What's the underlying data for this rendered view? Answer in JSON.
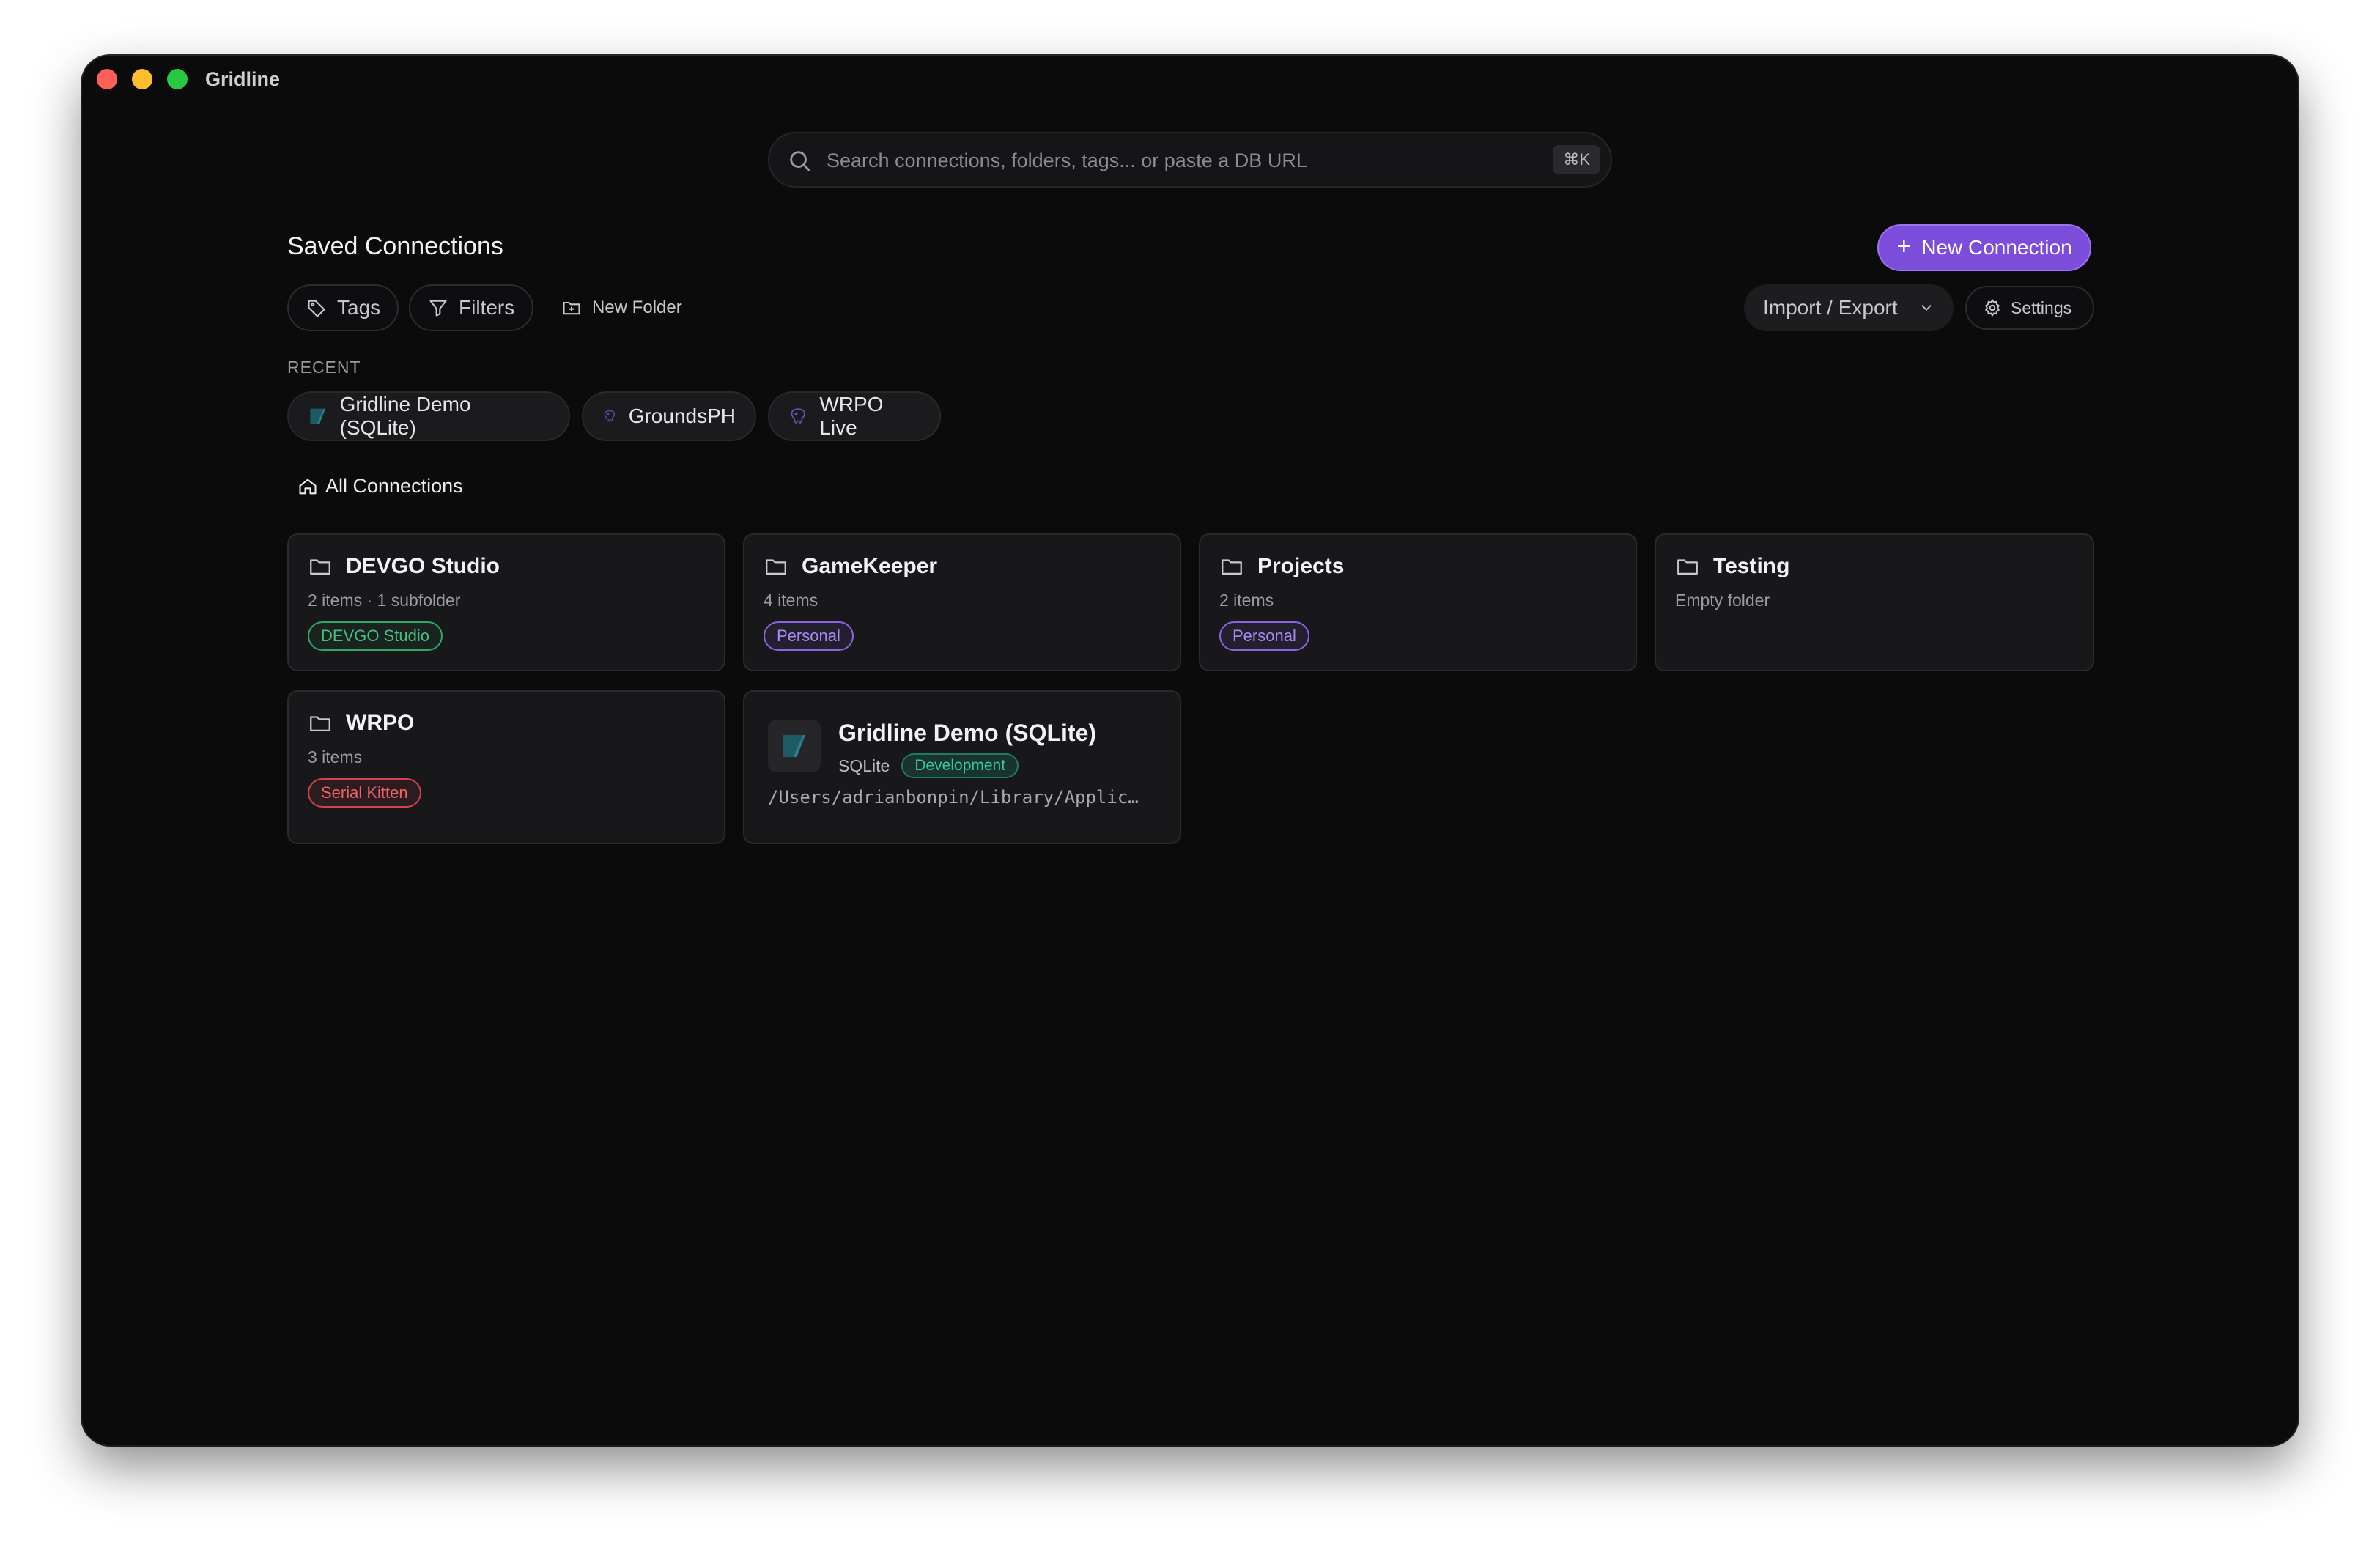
{
  "app": {
    "title": "Gridline"
  },
  "search": {
    "placeholder": "Search connections, folders, tags... or paste a DB URL",
    "shortcut": "⌘K"
  },
  "header": {
    "title": "Saved Connections",
    "new_connection": "New Connection",
    "tags": "Tags",
    "filters": "Filters",
    "new_folder": "New Folder",
    "import_export": "Import / Export",
    "settings": "Settings"
  },
  "recent": {
    "label": "RECENT",
    "items": [
      {
        "label": "Gridline Demo (SQLite)",
        "icon": "sqlite-icon"
      },
      {
        "label": "GroundsPH",
        "icon": "postgres-icon"
      },
      {
        "label": "WRPO Live",
        "icon": "postgres-icon"
      }
    ]
  },
  "breadcrumb": {
    "label": "All Connections"
  },
  "folders": [
    {
      "name": "DEVGO Studio",
      "meta": "2 items · 1 subfolder",
      "tag": "DEVGO Studio",
      "tag_color": "#2fa866"
    },
    {
      "name": "GameKeeper",
      "meta": "4 items",
      "tag": "Personal",
      "tag_color": "#8a63e0"
    },
    {
      "name": "Projects",
      "meta": "2 items",
      "tag": "Personal",
      "tag_color": "#8a63e0"
    },
    {
      "name": "Testing",
      "meta": "Empty folder",
      "tag": ""
    },
    {
      "name": "WRPO",
      "meta": "3 items",
      "tag": "Serial Kitten",
      "tag_color": "#d2434a"
    }
  ],
  "connection": {
    "name": "Gridline Demo (SQLite)",
    "type": "SQLite",
    "tag": "Development",
    "path": "/Users/adrianbonpin/Library/Applic…"
  },
  "colors": {
    "accent": "#7c4ddb",
    "background": "#0b0b0c",
    "card": "#18181a"
  }
}
